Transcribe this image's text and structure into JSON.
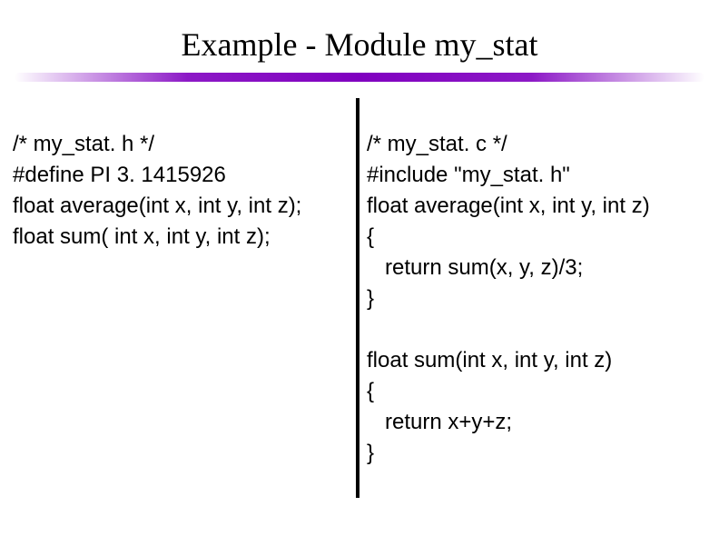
{
  "title": "Example - Module my_stat",
  "left": {
    "l1": "/* my_stat. h */",
    "l2": "#define PI 3. 1415926",
    "l3": "float average(int x, int y, int z);",
    "l4": "float sum( int x, int y, int z);"
  },
  "right": {
    "l1": "/* my_stat. c */",
    "l2": "#include \"my_stat. h\"",
    "l3": "float average(int x, int y, int z)",
    "l4": "{",
    "l5": "   return sum(x, y, z)/3;",
    "l6": "}",
    "l7": "",
    "l8": "float sum(int x, int y, int z)",
    "l9": "{",
    "l10": "   return x+y+z;",
    "l11": "}"
  }
}
